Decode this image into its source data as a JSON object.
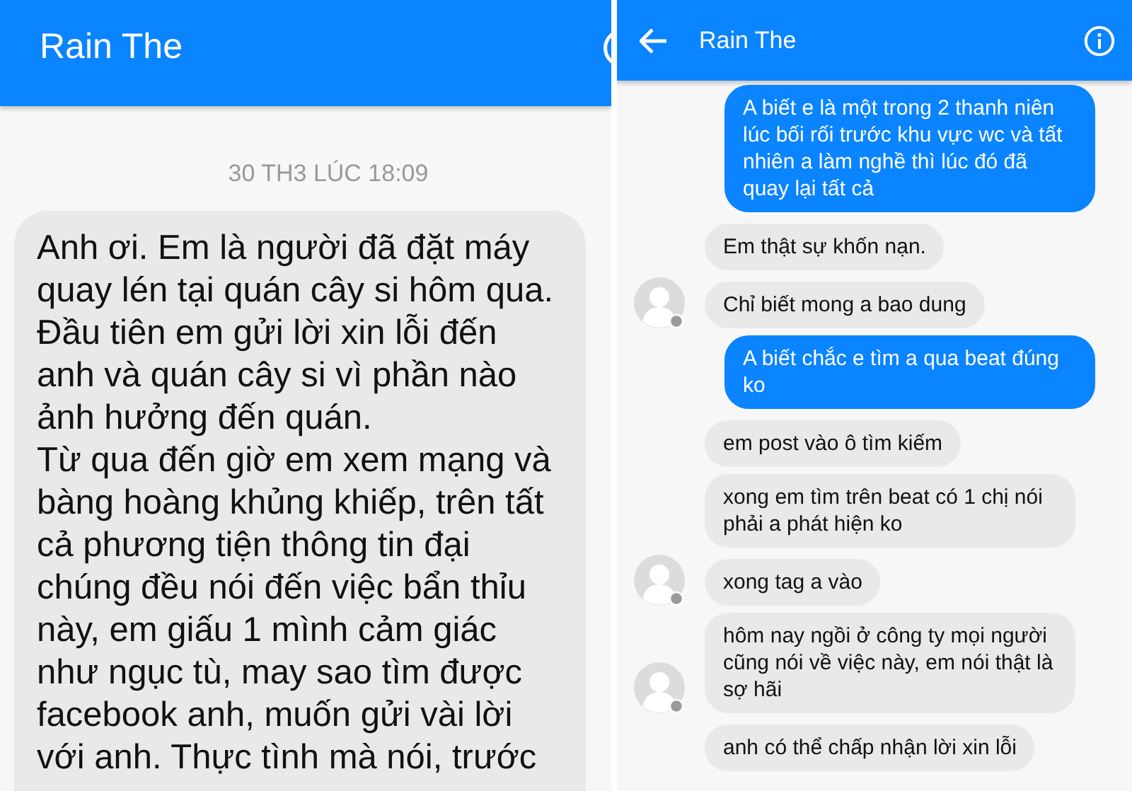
{
  "panels": [
    {
      "kind": "zoomed",
      "title": "Rain The",
      "date": "30 TH3 LÚC 18:09",
      "messages": [
        {
          "kind": "received",
          "text": "Anh ơi. Em là người đã đặt máy quay lén tại quán cây si hôm qua. Đầu tiên em gửi lời xin lỗi đến anh và quán cây si vì phần nào ảnh hưởng đến quán.\nTừ qua đến giờ em xem mạng và bàng hoàng khủng khiếp, trên tất cả phương tiện thông tin đại chúng đều nói đến việc bẩn thỉu này, em giấu 1 mình cảm giác như ngục tù, may sao tìm được facebook anh, muốn gửi vài lời với anh. Thực tình mà nói, trước"
        }
      ]
    },
    {
      "kind": "normal",
      "title": "Rain The",
      "back_button": true,
      "messages": [
        {
          "kind": "sent",
          "text": "A biết e là một trong 2 thanh niên lúc bối rối trước khu vực wc và tất nhiên a làm nghề thì lúc đó đã quay lại tất cả"
        },
        {
          "kind": "received",
          "avatar": false,
          "text": "Em thật sự khốn nạn."
        },
        {
          "kind": "received",
          "avatar": true,
          "text": "Chỉ biết mong a bao dung"
        },
        {
          "kind": "sent",
          "text": "A biết chắc e tìm a qua beat đúng ko"
        },
        {
          "kind": "received",
          "avatar": false,
          "text": "em post vào ô tìm kiếm"
        },
        {
          "kind": "received",
          "avatar": false,
          "text": "xong em tìm trên beat có 1 chị nói phải a phát hiện ko"
        },
        {
          "kind": "received",
          "avatar": true,
          "text": "xong tag a vào"
        },
        {
          "kind": "received",
          "avatar": true,
          "text": "hôm nay ngồi ở công ty mọi người cũng nói về việc này, em nói thật là sợ hãi"
        },
        {
          "kind": "received",
          "avatar": false,
          "text": "anh có thể chấp nhận lời xin lỗi"
        }
      ]
    }
  ]
}
